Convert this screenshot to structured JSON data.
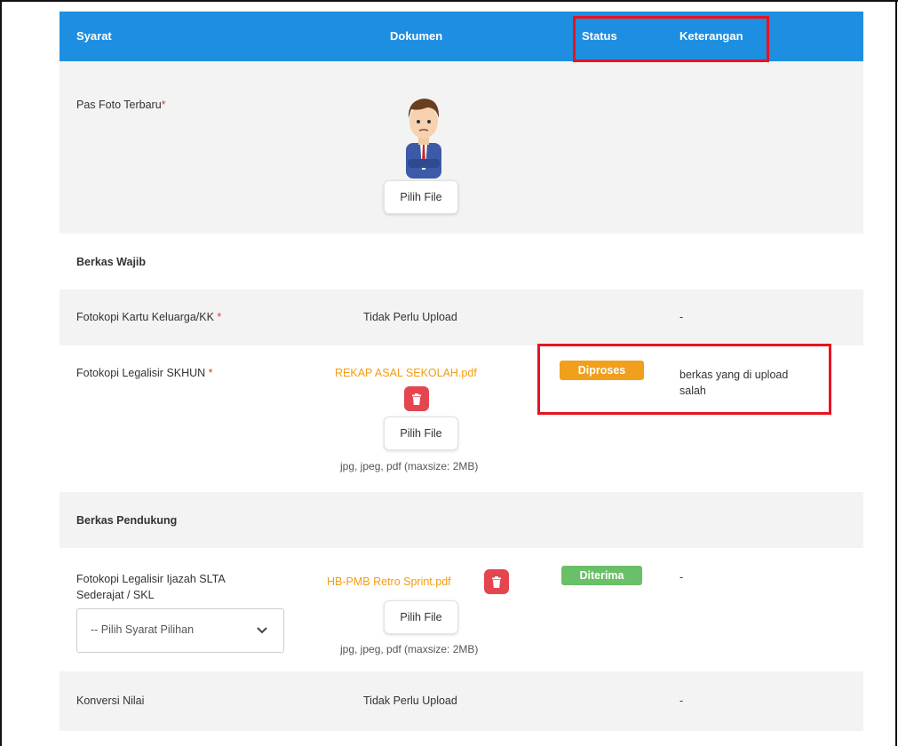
{
  "header": {
    "syarat": "Syarat",
    "dokumen": "Dokumen",
    "status": "Status",
    "keterangan": "Keterangan"
  },
  "pas_foto": {
    "label": "Pas Foto Terbaru",
    "required_mark": "*",
    "button": "Pilih File"
  },
  "section_wajib": "Berkas Wajib",
  "kk": {
    "label": "Fotokopi Kartu Keluarga/KK",
    "required_mark": " *",
    "dokumen": "Tidak Perlu Upload",
    "keterangan": "-"
  },
  "skhun": {
    "label": "Fotokopi Legalisir SKHUN",
    "required_mark": " *",
    "file": "REKAP ASAL SEKOLAH.pdf",
    "button": "Pilih File",
    "hint": "jpg, jpeg, pdf (maxsize: 2MB)",
    "status": "Diproses",
    "status_color": "#f0a01c",
    "keterangan_line1": "berkas yang di upload",
    "keterangan_line2": "salah"
  },
  "section_pendukung": "Berkas Pendukung",
  "ijazah": {
    "label_line1": "Fotokopi Legalisir Ijazah SLTA",
    "label_line2": "Sederajat / SKL",
    "select_value": "-- Pilih Syarat Pilihan",
    "file": "HB-PMB Retro Sprint.pdf",
    "button": "Pilih File",
    "hint": "jpg, jpeg, pdf (maxsize: 2MB)",
    "status": "Diterima",
    "status_color": "#6abf69",
    "keterangan": "-"
  },
  "konversi": {
    "label": "Konversi Nilai",
    "dokumen": "Tidak Perlu Upload",
    "keterangan": "-"
  },
  "colors": {
    "header_bg": "#1e8ee0",
    "highlight_box": "#e8121f",
    "file_link": "#f39c12",
    "delete_button": "#e5454f"
  },
  "icons": [
    "avatar-illustration",
    "trash-icon",
    "chevron-down-icon"
  ]
}
